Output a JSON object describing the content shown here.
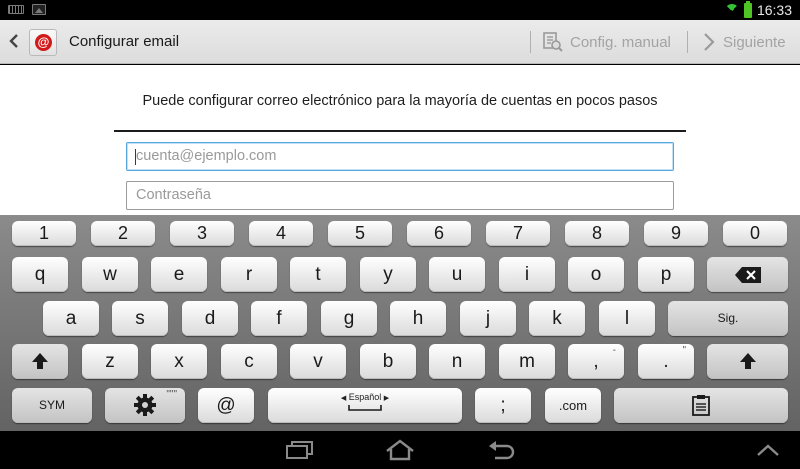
{
  "status_bar": {
    "time": "16:33"
  },
  "action_bar": {
    "title": "Configurar email",
    "manual_label": "Config. manual",
    "next_label": "Siguiente",
    "app_icon_glyph": "@"
  },
  "content": {
    "description": "Puede configurar correo electrónico para la mayoría de cuentas en pocos pasos",
    "email_placeholder": "cuenta@ejemplo.com",
    "password_placeholder": "Contraseña"
  },
  "keyboard": {
    "number_row": [
      "1",
      "2",
      "3",
      "4",
      "5",
      "6",
      "7",
      "8",
      "9",
      "0"
    ],
    "row1": [
      "q",
      "w",
      "e",
      "r",
      "t",
      "y",
      "u",
      "i",
      "o",
      "p"
    ],
    "row2": [
      "a",
      "s",
      "d",
      "f",
      "g",
      "h",
      "j",
      "k",
      "l"
    ],
    "row3": [
      "z",
      "x",
      "c",
      "v",
      "b",
      "n",
      "m"
    ],
    "comma_main": ",",
    "comma_alt": "-",
    "period_main": ".",
    "period_alt": "\"",
    "sig_label": "Sig.",
    "sym_label": "SYM",
    "settings_alt": "\"\"\"",
    "at_label": "@",
    "space_label": "Español",
    "semicolon_label": ";",
    "com_label": ".com"
  },
  "colors": {
    "accent": "#5aa7e0",
    "app_icon_red": "#d11a1a",
    "battery_green": "#4ec524"
  }
}
